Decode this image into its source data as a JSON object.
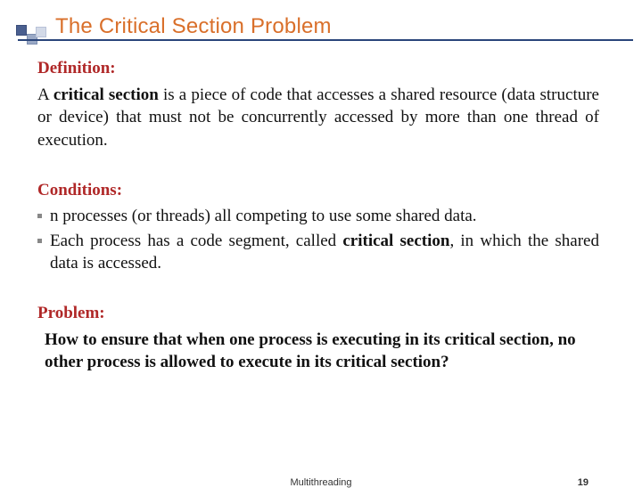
{
  "title": "The Critical Section Problem",
  "definition": {
    "heading": "Definition:",
    "body_pre": "A ",
    "body_bold": "critical section",
    "body_post": " is a piece of code that accesses a shared resource (data structure or device) that must not be concurrently accessed by more than one thread of execution."
  },
  "conditions": {
    "heading": "Conditions:",
    "items": [
      {
        "pre": "n processes (or threads) all competing to use some shared data.",
        "bold": "",
        "post": ""
      },
      {
        "pre": "Each process has a code segment, called ",
        "bold": "critical section",
        "post": ", in which the shared data is accessed."
      }
    ]
  },
  "problem": {
    "heading": "Problem:",
    "body": "How to ensure that when one process is executing in its critical section, no other process is allowed to execute in its critical section?"
  },
  "footer": {
    "label": "Multithreading",
    "page": "19"
  }
}
